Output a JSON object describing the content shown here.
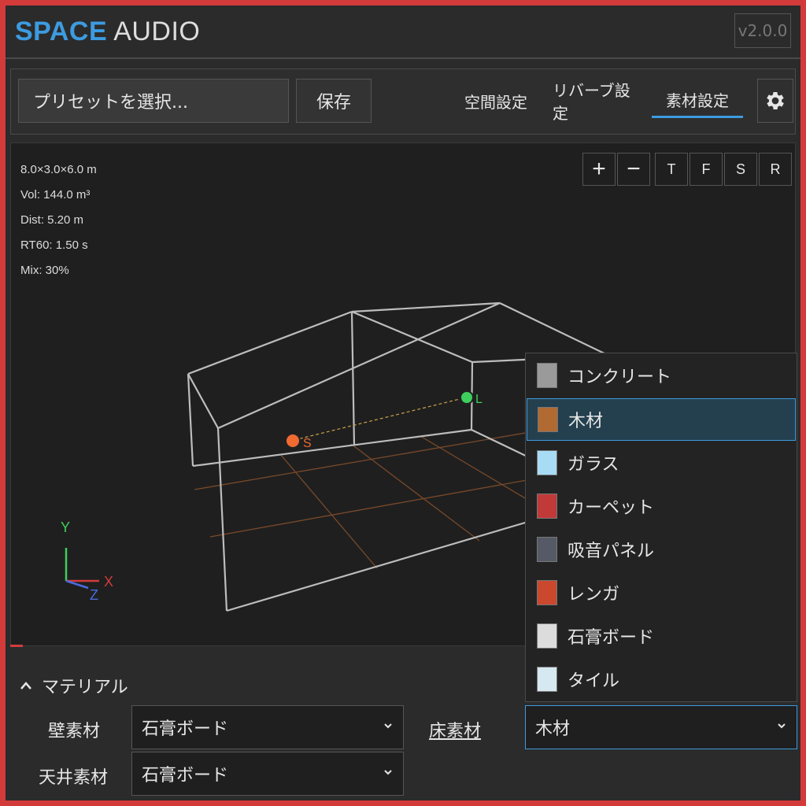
{
  "app": {
    "brand_1": "SPACE",
    "brand_2": "AUDIO",
    "version": "v2.0.0"
  },
  "toolbar": {
    "preset_placeholder": "プリセットを選択...",
    "save_label": "保存",
    "tabs": [
      {
        "label": "空間設定"
      },
      {
        "label": "リバーブ設定"
      },
      {
        "label": "素材設定",
        "active": true
      }
    ],
    "settings_icon": "gear-icon"
  },
  "viewport": {
    "info": {
      "dims": "8.0×3.0×6.0 m",
      "vol": "Vol: 144.0 m³",
      "dist": "Dist: 5.20 m",
      "rt60": "RT60: 1.50 s",
      "mix": "Mix: 30%"
    },
    "buttons": {
      "zoom_in": "+",
      "zoom_out": "−",
      "top": "T",
      "front": "F",
      "side": "S",
      "reset": "R"
    },
    "source_label": "S",
    "listener_label": "L",
    "axes": {
      "x": "X",
      "y": "Y",
      "z": "Z"
    },
    "colors": {
      "source": "#f06a32",
      "listener": "#3ecf5c",
      "floor_grid": "#7a4a2a"
    }
  },
  "material_menu": {
    "items": [
      {
        "label": "コンクリート",
        "color": "#9a9a9a"
      },
      {
        "label": "木材",
        "color": "#b06a32",
        "selected": true
      },
      {
        "label": "ガラス",
        "color": "#a8dcf5"
      },
      {
        "label": "カーペット",
        "color": "#c03a3a"
      },
      {
        "label": "吸音パネル",
        "color": "#555a66"
      },
      {
        "label": "レンガ",
        "color": "#c9482e"
      },
      {
        "label": "石膏ボード",
        "color": "#dcdcdc"
      },
      {
        "label": "タイル",
        "color": "#d6e8f0"
      }
    ]
  },
  "materials": {
    "header": "マテリアル",
    "wall_label": "壁素材",
    "wall_value": "石膏ボード",
    "floor_label": "床素材",
    "floor_value": "木材",
    "ceiling_label": "天井素材",
    "ceiling_value": "石膏ボード"
  }
}
